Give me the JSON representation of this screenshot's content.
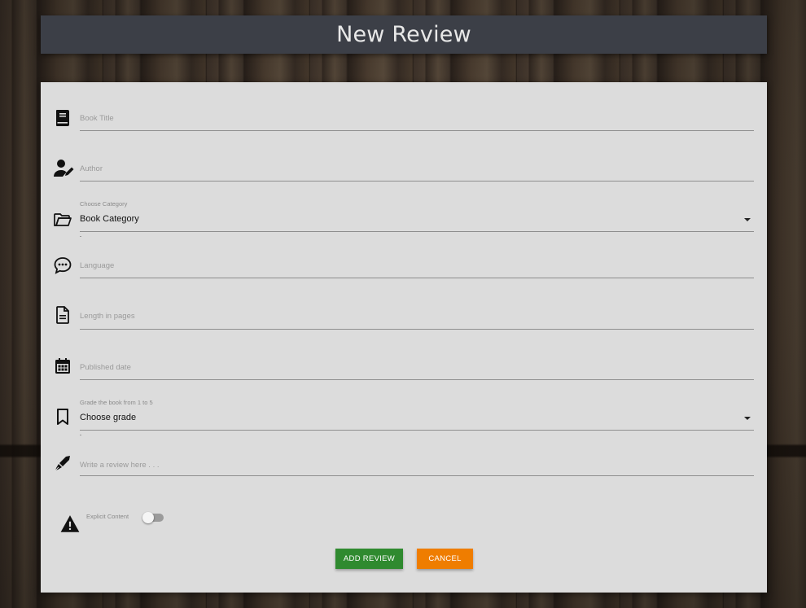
{
  "header": {
    "title": "New Review"
  },
  "form": {
    "book_title": {
      "placeholder": "Book Title",
      "icon": "book-icon"
    },
    "author": {
      "placeholder": "Author",
      "icon": "author-edit-icon"
    },
    "category": {
      "label": "Choose Category",
      "value": "Book Category",
      "icon": "folder-open-icon"
    },
    "language": {
      "placeholder": "Language",
      "icon": "chat-bubble-icon"
    },
    "length": {
      "placeholder": "Length in pages",
      "icon": "document-icon"
    },
    "published": {
      "placeholder": "Published date",
      "icon": "calendar-icon"
    },
    "grade": {
      "label": "Grade the book from 1 to 5",
      "value": "Choose grade",
      "icon": "bookmark-icon"
    },
    "review": {
      "placeholder": "Write a review here . . .",
      "icon": "fountain-pen-icon"
    },
    "explicit": {
      "label": "Explicit Content",
      "checked": false,
      "icon": "warning-icon"
    }
  },
  "buttons": {
    "add_label": "ADD REVIEW",
    "cancel_label": "CANCEL"
  },
  "colors": {
    "header_bg": "#3c3f47",
    "card_bg": "#dcdcdc",
    "add_button": "#2f8a2f",
    "cancel_button": "#ef7d00"
  }
}
